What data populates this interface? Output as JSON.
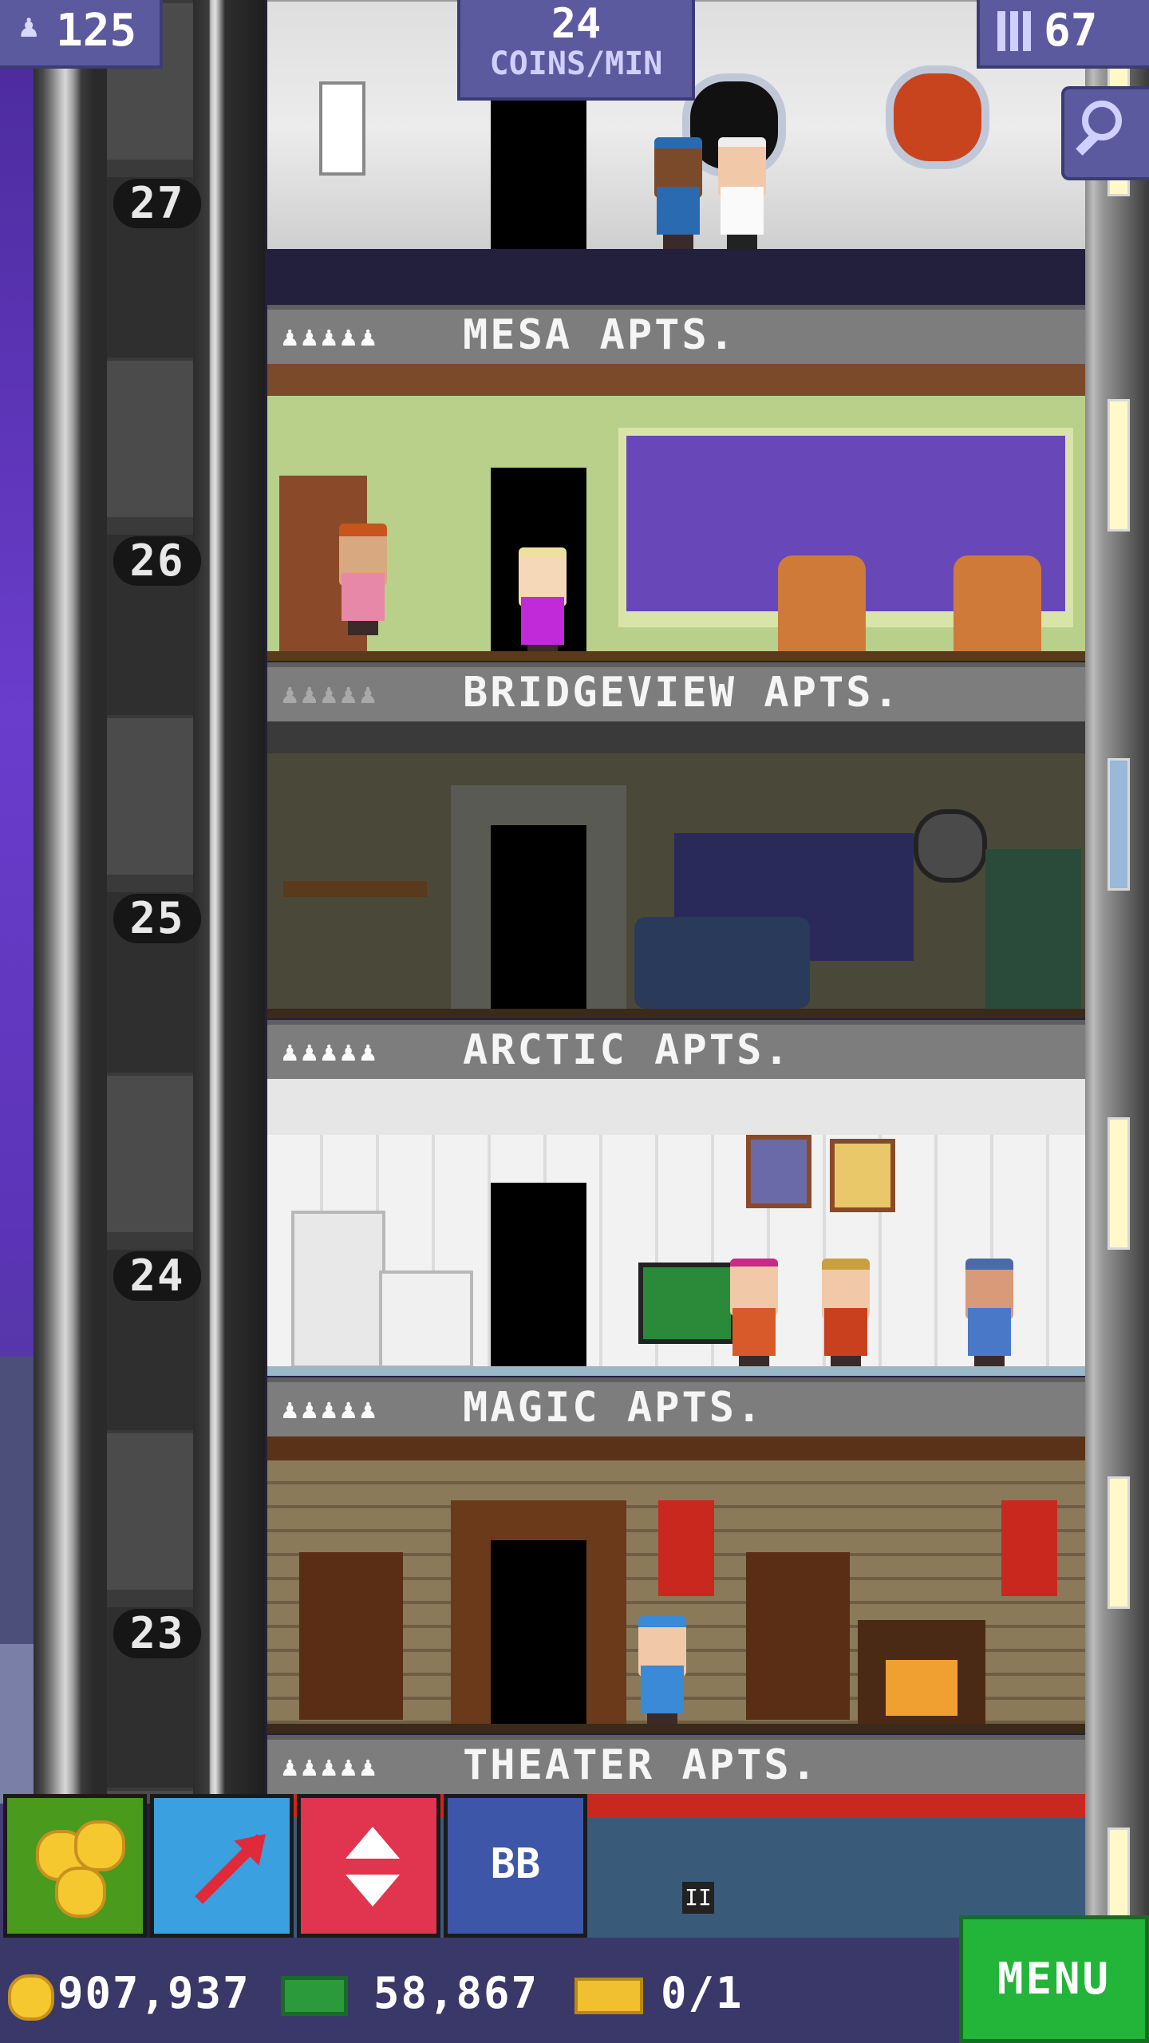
{
  "hud": {
    "population": "125",
    "coins_rate": "24",
    "coins_rate_unit": "COINS/MIN",
    "floors": "67"
  },
  "floors": [
    {
      "number": "27",
      "name": "",
      "label_above": ""
    },
    {
      "number": "26",
      "name": "MESA APTS.",
      "stars": "♟♟♟♟♟"
    },
    {
      "number": "25",
      "name": "BRIDGEVIEW APTS.",
      "stars": "♟♟♟♟♟"
    },
    {
      "number": "24",
      "name": "ARCTIC APTS.",
      "stars": "♟♟♟♟♟"
    },
    {
      "number": "23",
      "name": "MAGIC APTS.",
      "stars": "♟♟♟♟♟"
    },
    {
      "number": "",
      "name": "THEATER APTS.",
      "stars": "♟♟♟♟♟"
    }
  ],
  "toolbar": {
    "coins_icon": "coins-icon",
    "build_icon": "arrow-icon",
    "elevator_icon": "elevator-updown-icon",
    "bb_label": "BB"
  },
  "bottom": {
    "coins": "907,937",
    "bux": "58,867",
    "tickets": "0/1",
    "menu_label": "MENU"
  },
  "colors": {
    "hud_bg": "#5b5a9e",
    "menu_green": "#23b43a",
    "coins_button": "#4a9a1e",
    "build_button": "#3aa0e0",
    "elevator_button": "#e0344f",
    "bb_button": "#3d56a8"
  }
}
